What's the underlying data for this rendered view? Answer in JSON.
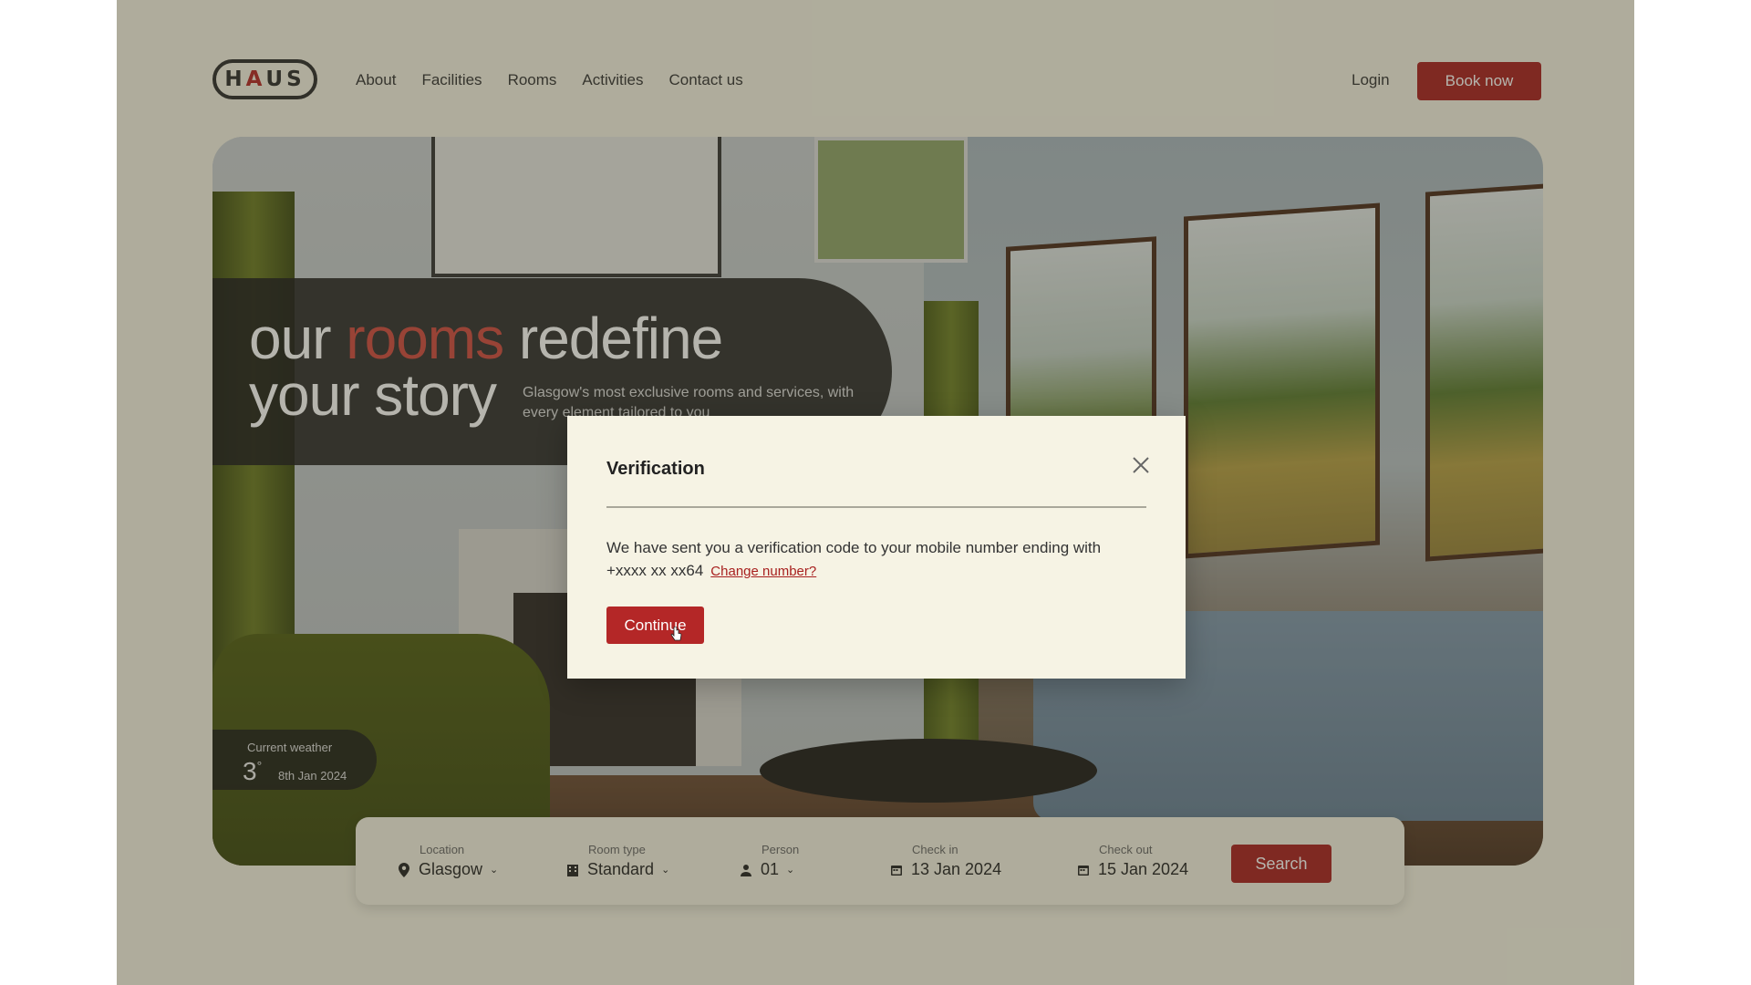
{
  "header": {
    "logo_text_1": "H",
    "logo_text_2": "A",
    "logo_text_3": "US",
    "nav": [
      "About",
      "Facilities",
      "Rooms",
      "Activities",
      "Contact us"
    ],
    "login_label": "Login",
    "book_label": "Book now"
  },
  "hero": {
    "title_word_1": "our",
    "title_accent": "rooms",
    "title_word_2": "redefine",
    "title_line_2": "your story",
    "subtitle": "Glasgow's most exclusive rooms and services, with every element tailored to you"
  },
  "weather": {
    "label": "Current weather",
    "temperature": "3",
    "degree_symbol": "°",
    "date": "8th Jan 2024"
  },
  "search": {
    "location_label": "Location",
    "location_value": "Glasgow",
    "room_type_label": "Room type",
    "room_type_value": "Standard",
    "person_label": "Person",
    "person_value": "01",
    "checkin_label": "Check in",
    "checkin_value": "13 Jan 2024",
    "checkout_label": "Check out",
    "checkout_value": "15 Jan 2024",
    "search_label": "Search"
  },
  "modal": {
    "title": "Verification",
    "message": "We have sent you a verification code to your mobile number ending with +xxxx xx xx64",
    "change_link": "Change number?",
    "continue_label": "Continue",
    "close_icon": "close-icon"
  },
  "colors": {
    "accent": "#a8201f",
    "background": "#f6f3e4",
    "text": "#222222"
  }
}
